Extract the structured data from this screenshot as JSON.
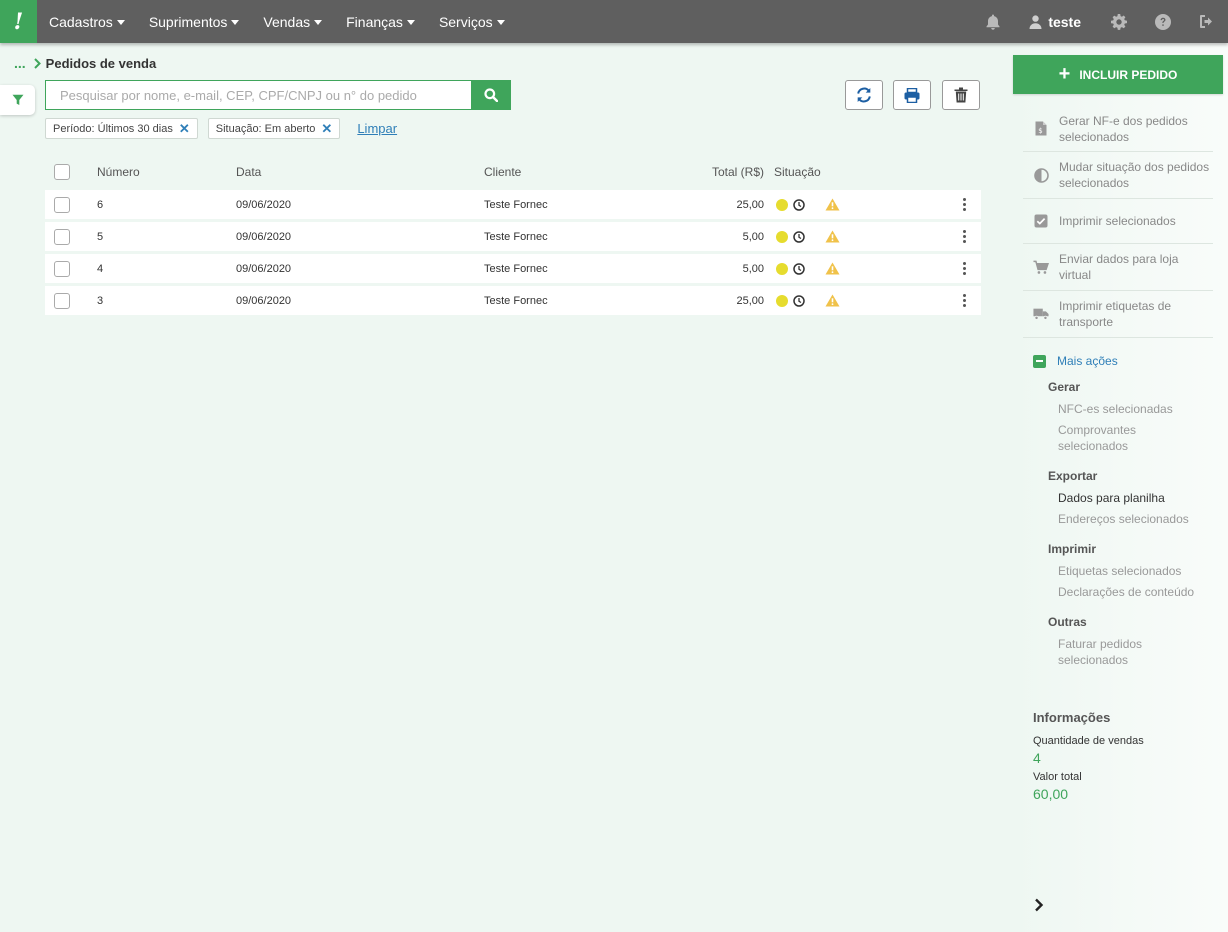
{
  "nav": {
    "logo": "!",
    "menu": [
      {
        "label": "Cadastros"
      },
      {
        "label": "Suprimentos"
      },
      {
        "label": "Vendas"
      },
      {
        "label": "Finanças"
      },
      {
        "label": "Serviços"
      }
    ],
    "user": "teste"
  },
  "breadcrumb": {
    "ellipsis": "...",
    "title": "Pedidos de venda"
  },
  "search": {
    "placeholder": "Pesquisar por nome, e-mail, CEP, CPF/CNPJ ou n° do pedido"
  },
  "filters": {
    "chips": [
      {
        "label": "Período: Últimos 30 dias"
      },
      {
        "label": "Situação: Em aberto"
      }
    ],
    "clear_label": "Limpar"
  },
  "table": {
    "headers": {
      "number": "Número",
      "date": "Data",
      "client": "Cliente",
      "total": "Total (R$)",
      "status": "Situação"
    },
    "rows": [
      {
        "number": "6",
        "date": "09/06/2020",
        "client": "Teste Fornec",
        "total": "25,00"
      },
      {
        "number": "5",
        "date": "09/06/2020",
        "client": "Teste Fornec",
        "total": "5,00"
      },
      {
        "number": "4",
        "date": "09/06/2020",
        "client": "Teste Fornec",
        "total": "5,00"
      },
      {
        "number": "3",
        "date": "09/06/2020",
        "client": "Teste Fornec",
        "total": "25,00"
      }
    ]
  },
  "sidebar": {
    "add_button": "INCLUIR PEDIDO",
    "actions": [
      {
        "label": "Gerar NF-e dos pedidos selecionados",
        "icon": "invoice-icon"
      },
      {
        "label": "Mudar situação dos pedidos selecionados",
        "icon": "contrast-icon"
      },
      {
        "label": "Imprimir selecionados",
        "icon": "checkbox-icon"
      },
      {
        "label": "Enviar dados para loja virtual",
        "icon": "cart-icon"
      },
      {
        "label": "Imprimir etiquetas de transporte",
        "icon": "truck-icon"
      }
    ],
    "more_actions": "Mais ações",
    "groups": {
      "gerar": {
        "title": "Gerar",
        "items": [
          "NFC-es selecionadas",
          "Comprovantes selecionados"
        ]
      },
      "exportar": {
        "title": "Exportar",
        "items": [
          "Dados para planilha",
          "Endereços selecionados"
        ]
      },
      "imprimir": {
        "title": "Imprimir",
        "items": [
          "Etiquetas selecionados",
          "Declarações de conteúdo"
        ]
      },
      "outras": {
        "title": "Outras",
        "items": [
          "Faturar pedidos selecionados"
        ]
      }
    },
    "info": {
      "title": "Informações",
      "count_label": "Quantidade de vendas",
      "count_value": "4",
      "total_label": "Valor total",
      "total_value": "60,00"
    }
  },
  "colors": {
    "brand": "#3fa55b",
    "topbar": "#5f5f5f",
    "link": "#2f7fb8",
    "status_dot": "#e6dc2e",
    "warning": "#f0c24a"
  }
}
